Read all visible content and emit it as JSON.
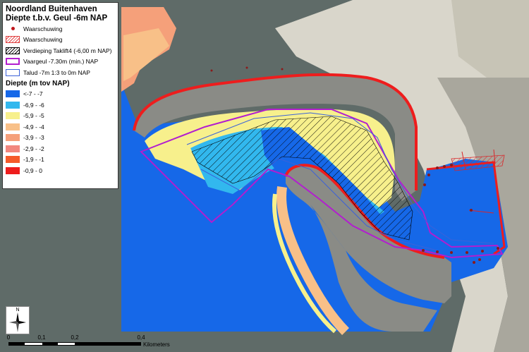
{
  "legend": {
    "title_line1": "Noordland Buitenhaven",
    "title_line2": "Diepte t.b.v. Geul -6m NAP",
    "layers": [
      {
        "label": "Waarschuwing",
        "swatch": "dot"
      },
      {
        "label": "Waarschuwing",
        "swatch": "hatch-red"
      },
      {
        "label": "Verdieping Taklift4 (-6,00 m NAP)",
        "swatch": "hatch-black"
      },
      {
        "label": "Vaargeul -7.30m (min.) NAP",
        "swatch": "purple"
      },
      {
        "label": "Talud -7m 1:3 to 0m NAP",
        "swatch": "blue"
      }
    ],
    "depth_heading": "Diepte (m tov NAP)",
    "depth_classes": [
      {
        "label": "<-7 - -7",
        "color": "#1668e8"
      },
      {
        "label": "-6,9 - -6",
        "color": "#32b8ee"
      },
      {
        "label": "-5,9 - -5",
        "color": "#f7f08c"
      },
      {
        "label": "-4,9 - -4",
        "color": "#f8c088"
      },
      {
        "label": "-3,9 - -3",
        "color": "#f5a07a"
      },
      {
        "label": "-2,9 - -2",
        "color": "#f2877e"
      },
      {
        "label": "-1,9 - -1",
        "color": "#f55a2a"
      },
      {
        "label": "-0,9 - 0",
        "color": "#ee1d1d"
      }
    ]
  },
  "north_arrow": {
    "label": "N"
  },
  "scale_bar": {
    "ticks": [
      "0",
      "0,1",
      "0,2",
      "0,4"
    ],
    "units": "Kilometers"
  },
  "colors": {
    "sea": "#5f6b68",
    "beach": "#dedbd1",
    "breakwater": "#8a8b86",
    "warning": "#c0171d",
    "channel": "#b21ecf",
    "talud": "#3b62d9"
  }
}
